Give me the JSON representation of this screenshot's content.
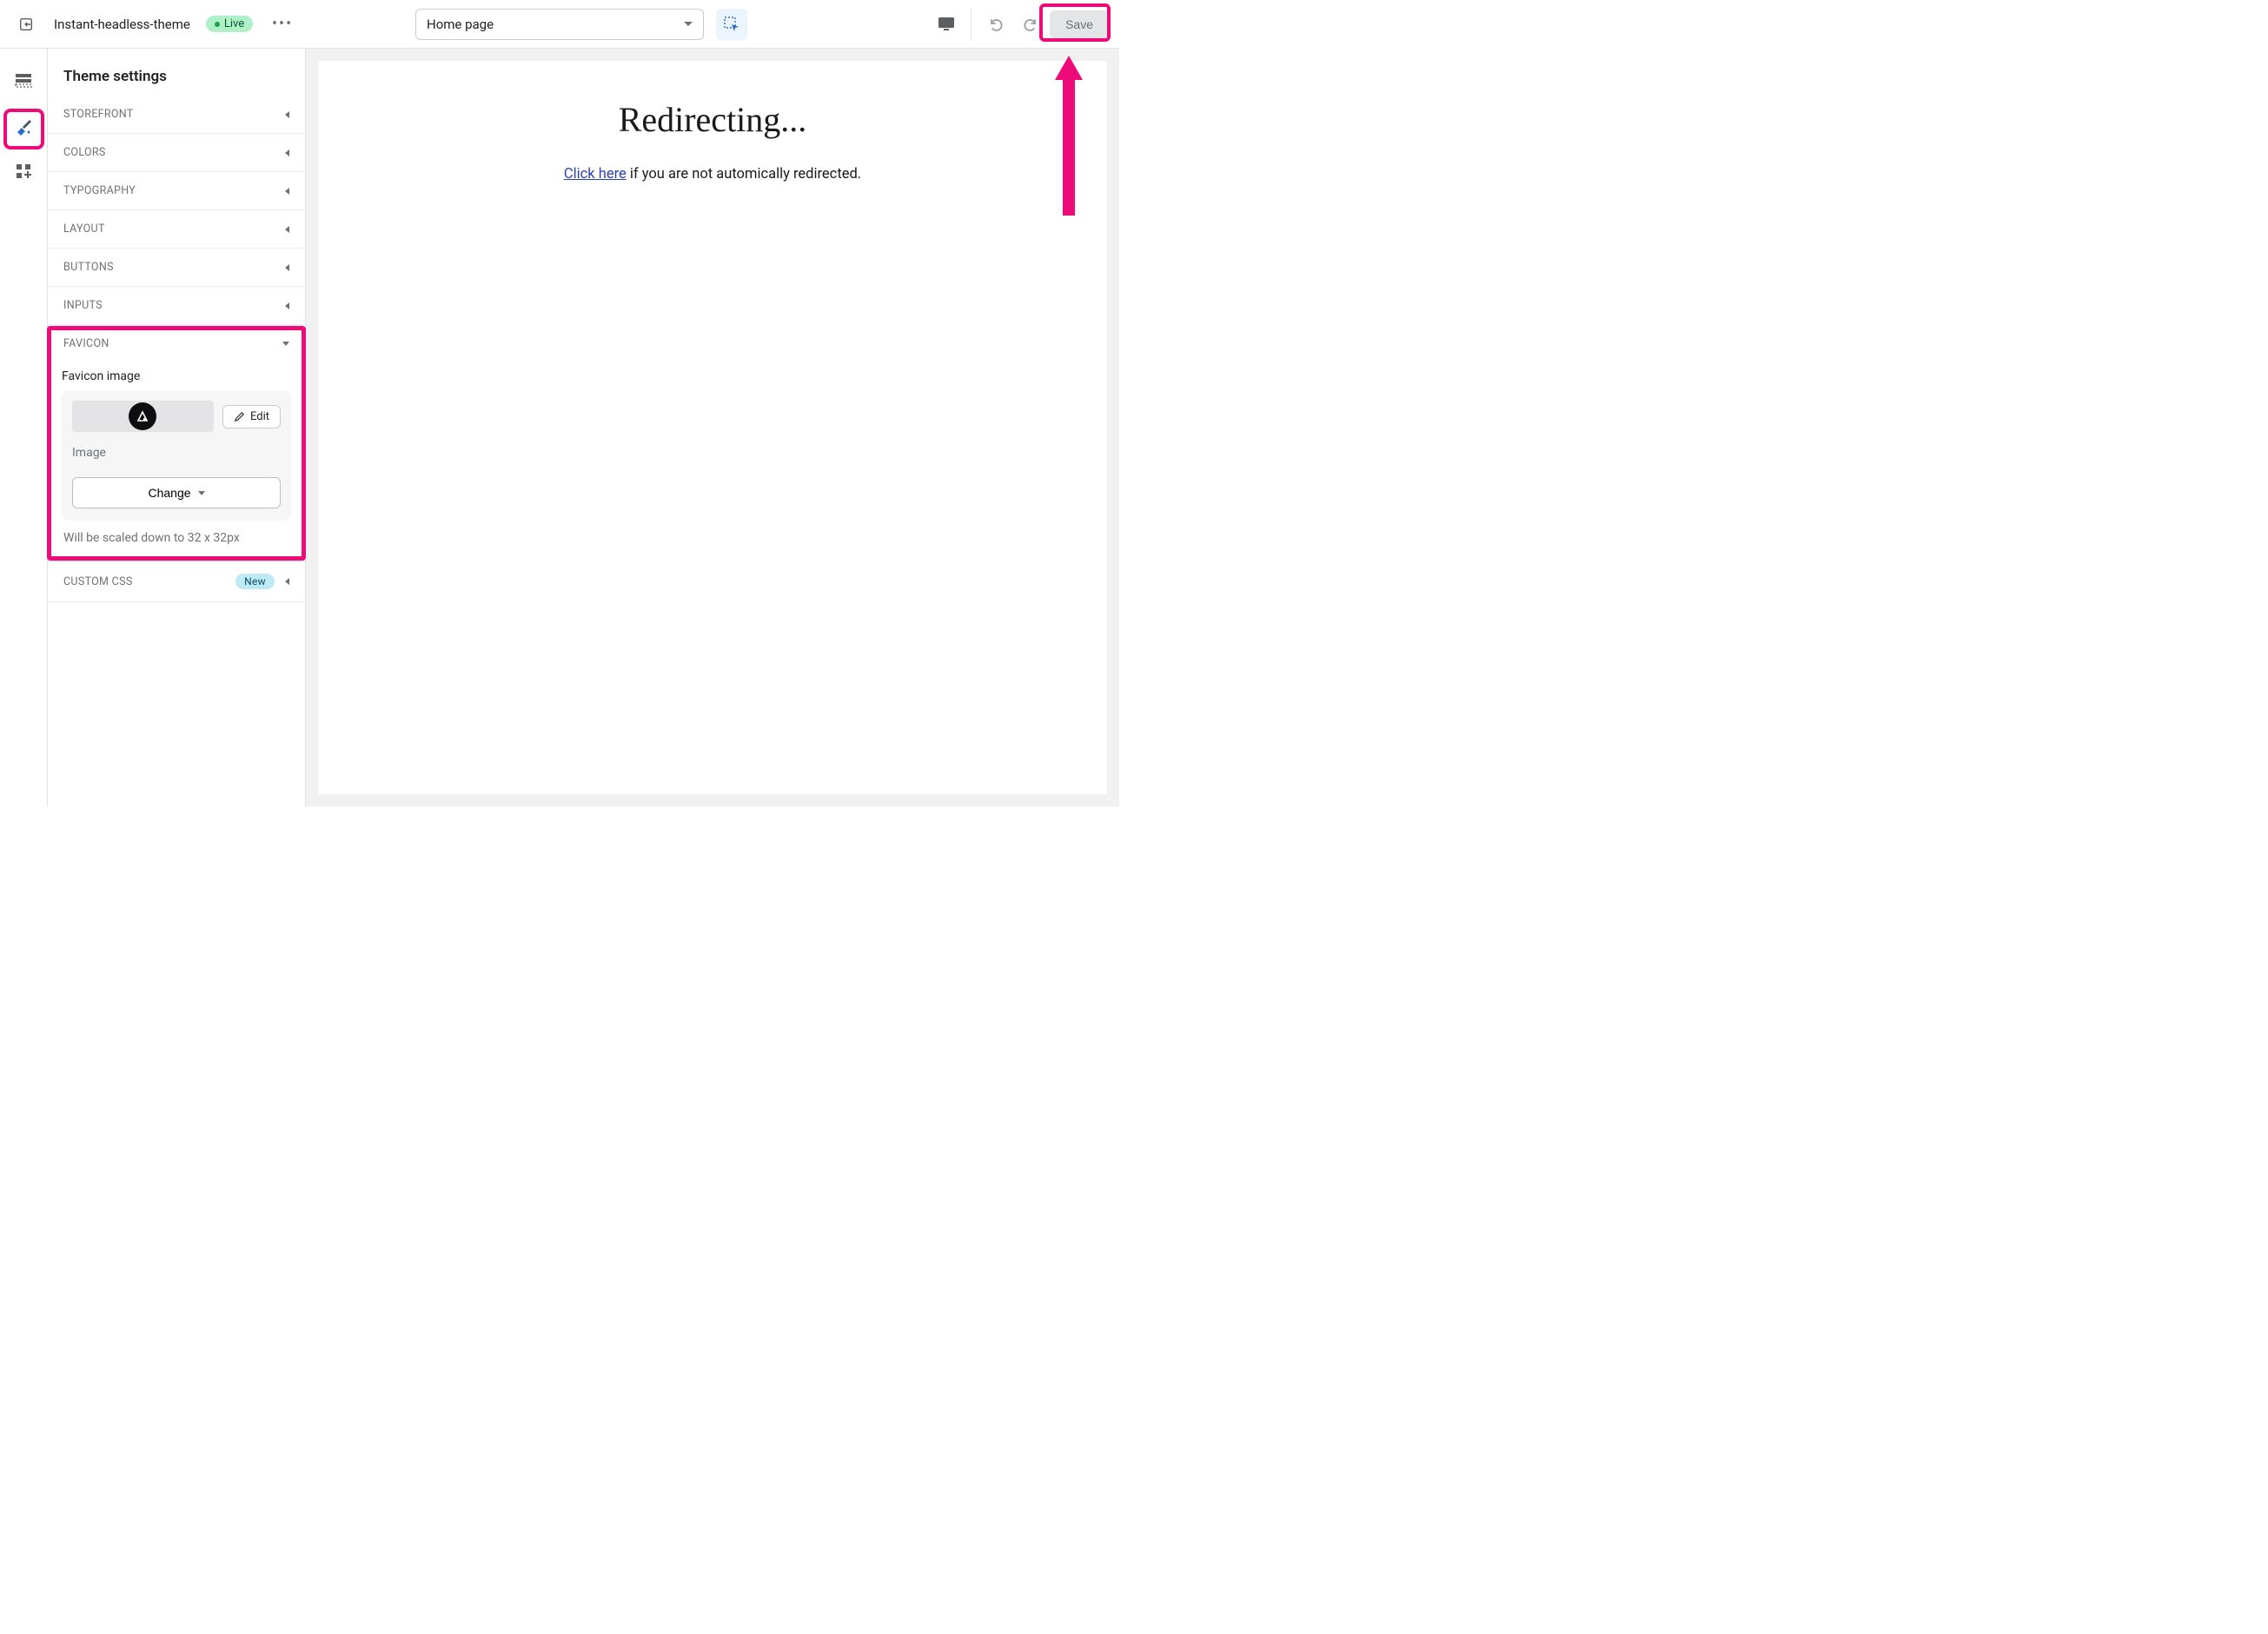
{
  "topbar": {
    "theme_name": "Instant-headless-theme",
    "live_label": "Live",
    "page_select": "Home page",
    "save_label": "Save"
  },
  "panel": {
    "title": "Theme settings",
    "sections": {
      "storefront": "Storefront",
      "colors": "Colors",
      "typography": "Typography",
      "layout": "Layout",
      "buttons": "Buttons",
      "inputs": "Inputs",
      "favicon": "Favicon",
      "custom_css": "Custom CSS"
    },
    "favicon": {
      "field_label": "Favicon image",
      "edit_label": "Edit",
      "image_caption": "Image",
      "change_label": "Change",
      "helper_text": "Will be scaled down to 32 x 32px"
    },
    "new_badge": "New"
  },
  "preview": {
    "title": "Redirecting...",
    "link_text": "Click here",
    "rest_text": " if you are not automically redirected."
  },
  "annotation": {
    "color": "#ee0a78"
  }
}
